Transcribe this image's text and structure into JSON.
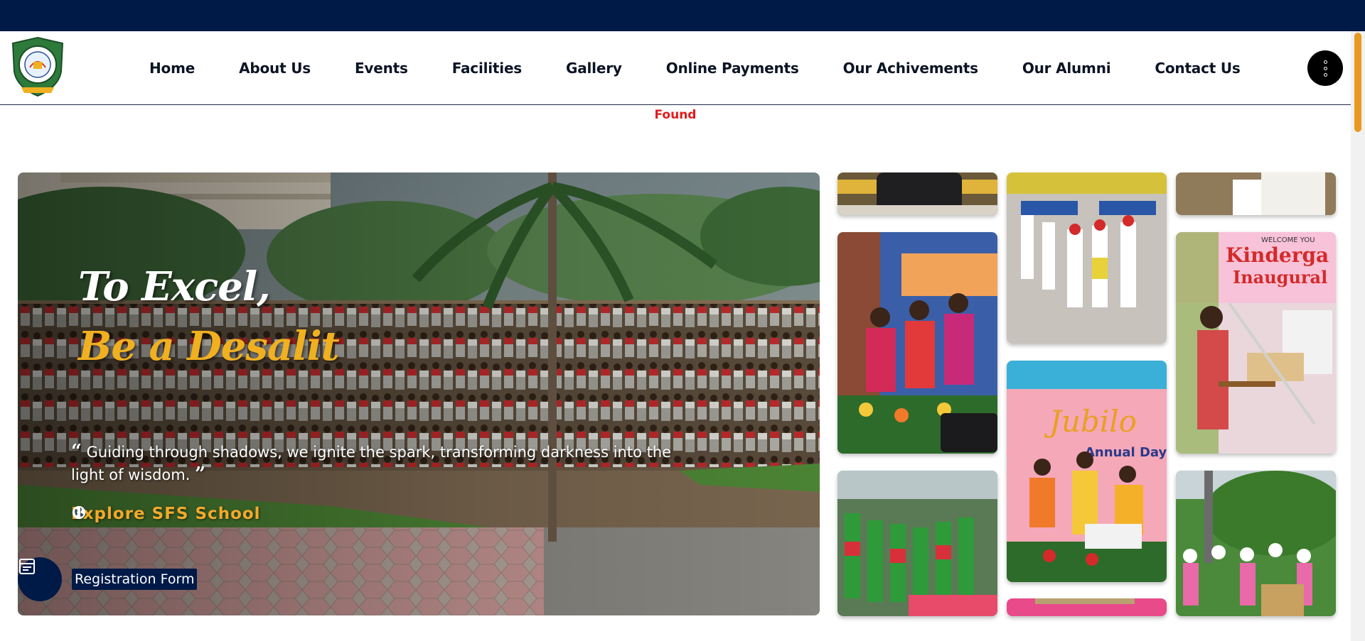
{
  "nav": {
    "items": [
      "Home",
      "About Us",
      "Events",
      "Facilities",
      "Gallery",
      "Online Payments",
      "Our Achivements",
      "Our Alumni",
      "Contact Us"
    ]
  },
  "status": {
    "found": "Found"
  },
  "hero": {
    "title_line1": "To Excel,",
    "title_line2": "Be a Desalit",
    "quote": "Guiding through shadows, we ignite the spark, transforming darkness into the light of wisdom.",
    "open_quote": "“",
    "close_quote": "”",
    "explore_label": "Explore SFS School",
    "registration_label": "Registration Form"
  },
  "gallery": {
    "banner_kindergarten": "Kinderga",
    "banner_inaugural": "Inaugural",
    "banner_welcome": "WELCOME YOU",
    "banner_annual": "Annual Day",
    "banner_jubilee": "Jubilo"
  },
  "colors": {
    "navy": "#001a47",
    "accent_orange": "#f3a92b",
    "status_red": "#e11b1b"
  },
  "icons": {
    "menu": "vertical-dots-icon",
    "explore": "globe-icon",
    "registration": "form-icon"
  }
}
